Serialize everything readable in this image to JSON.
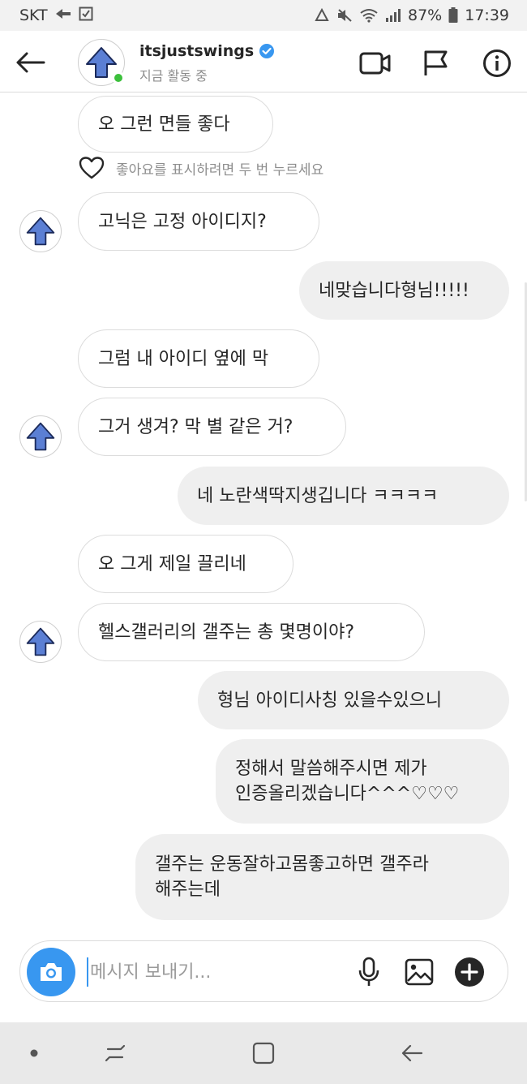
{
  "status_bar": {
    "carrier": "SKT",
    "battery": "87%",
    "time": "17:39"
  },
  "header": {
    "username": "itsjustswings",
    "activity_status": "지금 활동 중",
    "verified": true,
    "online": true
  },
  "like_hint": "좋아요를 표시하려면 두 번 누르세요",
  "messages": [
    {
      "from": "them",
      "lines": [
        "오 그런 면들 좋다"
      ]
    },
    {
      "from": "them",
      "lines": [
        "고닉은 고정 아이디지?"
      ]
    },
    {
      "from": "me",
      "lines": [
        "네맞습니다형님!!!!!"
      ]
    },
    {
      "from": "them",
      "lines": [
        "그럼 내 아이디 옆에 막"
      ]
    },
    {
      "from": "them",
      "lines": [
        "그거 생겨? 막 별 같은 거?"
      ]
    },
    {
      "from": "me",
      "lines": [
        "네 노란색딱지생깁니다 ㅋㅋㅋㅋ"
      ]
    },
    {
      "from": "them",
      "lines": [
        "오 그게 제일 끌리네"
      ]
    },
    {
      "from": "them",
      "lines": [
        "헬스갤러리의 갤주는 총 몇명이야?"
      ]
    },
    {
      "from": "me",
      "lines": [
        "형님 아이디사칭 있을수있으니"
      ]
    },
    {
      "from": "me",
      "lines": [
        "정해서 말씀해주시면 제가",
        "인증올리겠습니다^^^♡♡♡"
      ]
    },
    {
      "from": "me",
      "lines": [
        "갤주는 운동잘하고몸좋고하면 갤주라",
        "해주는데"
      ]
    }
  ],
  "composer": {
    "placeholder": "메시지 보내기..."
  },
  "colors": {
    "accent": "#3897f0",
    "online": "#3cc03c",
    "incoming_bubble_border": "#dcdcdc",
    "outgoing_bubble": "#efefef",
    "avatar_arrow": "#5b7fd4"
  },
  "icons": {
    "header": [
      "back-arrow-icon",
      "verified-badge-icon",
      "video-camera-icon",
      "flag-icon",
      "info-icon"
    ],
    "composer": [
      "camera-icon",
      "microphone-icon",
      "gallery-icon",
      "plus-circle-icon"
    ],
    "nav": [
      "nav-dot-icon",
      "recent-apps-icon",
      "home-icon",
      "back-icon"
    ]
  }
}
